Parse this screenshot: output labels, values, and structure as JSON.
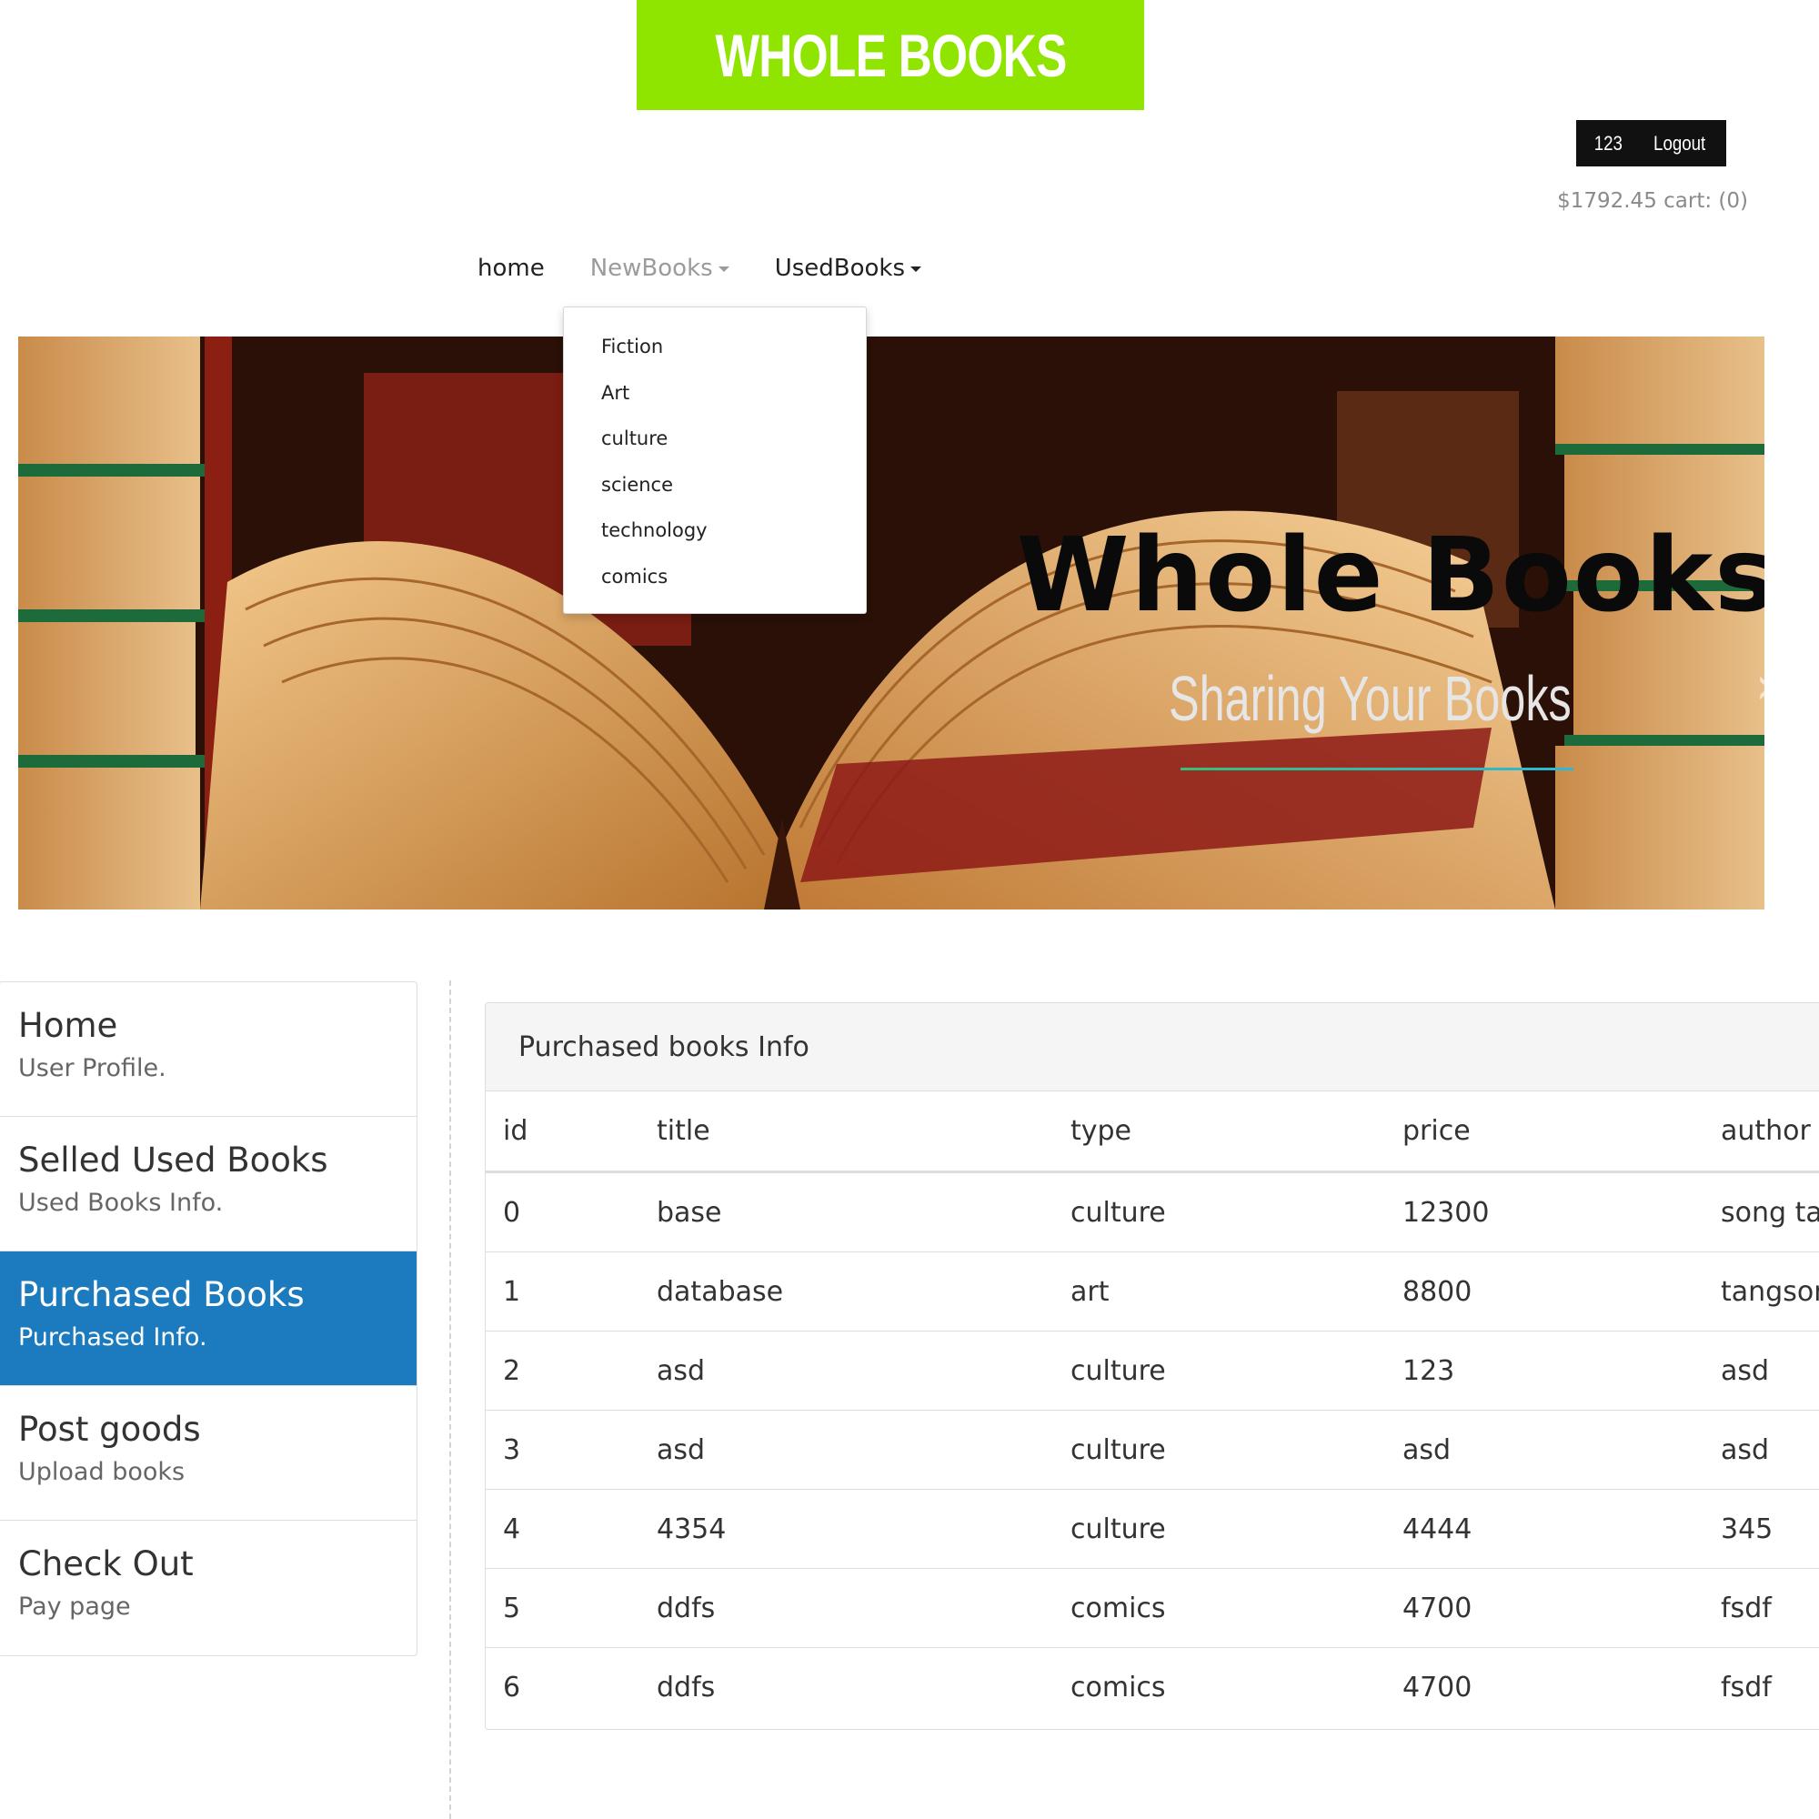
{
  "header": {
    "logo_text": "WHOLE BOOKS",
    "user_id": "123",
    "logout_label": "Logout",
    "cart_text": "$1792.45 cart: (0)"
  },
  "nav": {
    "home": "home",
    "new_books": "NewBooks",
    "used_books": "UsedBooks",
    "dropdown_items": [
      "Fiction",
      "Art",
      "culture",
      "science",
      "technology",
      "comics"
    ]
  },
  "hero": {
    "title": "Whole Books",
    "subtitle": "Sharing Your Books"
  },
  "sidebar": {
    "items": [
      {
        "title": "Home",
        "desc": "User Profile."
      },
      {
        "title": "Selled Used Books",
        "desc": "Used Books Info."
      },
      {
        "title": "Purchased Books",
        "desc": "Purchased Info."
      },
      {
        "title": "Post goods",
        "desc": "Upload books"
      },
      {
        "title": "Check Out",
        "desc": "Pay page"
      }
    ],
    "active_index": 2
  },
  "panel": {
    "heading": "Purchased books Info",
    "columns": [
      "id",
      "title",
      "type",
      "price",
      "author"
    ],
    "rows": [
      [
        "0",
        "base",
        "culture",
        "12300",
        "song tar"
      ],
      [
        "1",
        "database",
        "art",
        "8800",
        "tangson"
      ],
      [
        "2",
        "asd",
        "culture",
        "123",
        "asd"
      ],
      [
        "3",
        "asd",
        "culture",
        "asd",
        "asd"
      ],
      [
        "4",
        "4354",
        "culture",
        "4444",
        "345"
      ],
      [
        "5",
        "ddfs",
        "comics",
        "4700",
        "fsdf"
      ],
      [
        "6",
        "ddfs",
        "comics",
        "4700",
        "fsdf"
      ]
    ]
  },
  "colors": {
    "logo_bg": "#8fe500",
    "active_sidebar": "#1c7bbf",
    "userbar_bg": "#111111"
  }
}
